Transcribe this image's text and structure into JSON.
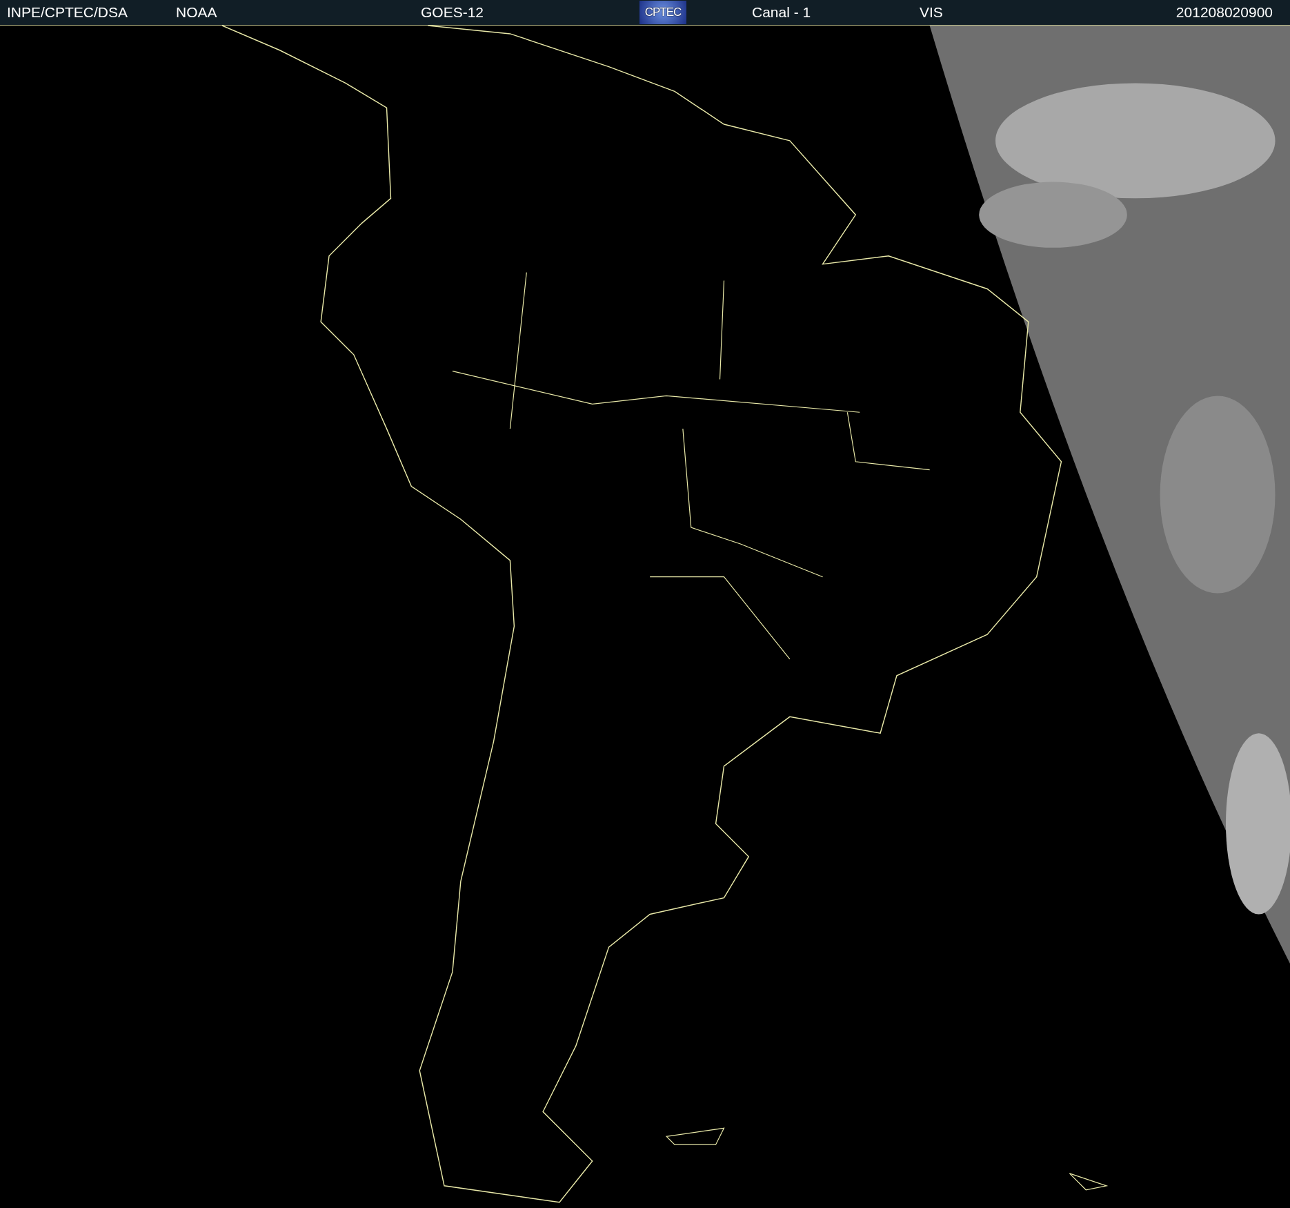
{
  "header": {
    "source": "INPE/CPTEC/DSA",
    "agency": "NOAA",
    "satellite": "GOES-12",
    "logo": "CPTEC",
    "channel": "Canal - 1",
    "band": "VIS",
    "timestamp": "201208020900"
  }
}
